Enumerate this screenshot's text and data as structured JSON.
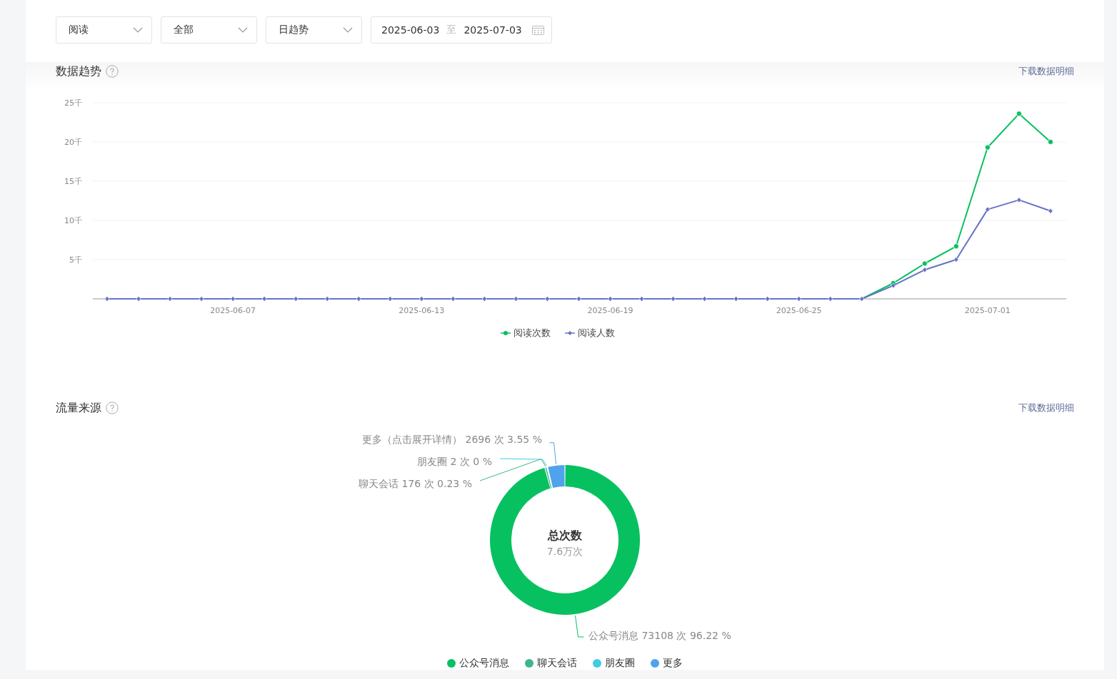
{
  "filters": [
    {
      "value": "阅读"
    },
    {
      "value": "全部"
    },
    {
      "value": "日趋势"
    }
  ],
  "date_range": {
    "start": "2025-06-03",
    "separator": "至",
    "end": "2025-07-03"
  },
  "trend": {
    "title": "数据趋势",
    "download": "下载数据明细",
    "chart_data": {
      "type": "line",
      "categories": [
        null,
        null,
        null,
        null,
        "2025-06-07",
        null,
        null,
        null,
        null,
        null,
        "2025-06-13",
        null,
        null,
        null,
        null,
        null,
        "2025-06-19",
        null,
        null,
        null,
        null,
        null,
        "2025-06-25",
        null,
        null,
        null,
        null,
        null,
        "2025-07-01",
        null,
        null
      ],
      "ylim": [
        0,
        25
      ],
      "yticks": [
        {
          "value": 5,
          "label": "5千"
        },
        {
          "value": 10,
          "label": "10千"
        },
        {
          "value": 15,
          "label": "15千"
        },
        {
          "value": 20,
          "label": "20千"
        },
        {
          "value": 25,
          "label": "25千"
        }
      ],
      "grid": true,
      "legend": "bottom",
      "series": [
        {
          "name": "阅读次数",
          "color": "#07c160",
          "marker": "circle",
          "values": [
            null,
            null,
            null,
            null,
            null,
            null,
            null,
            null,
            null,
            null,
            null,
            null,
            null,
            null,
            null,
            null,
            null,
            null,
            null,
            null,
            null,
            null,
            null,
            null,
            0,
            2,
            4.5,
            6.7,
            19.3,
            23.6,
            20
          ]
        },
        {
          "name": "阅读人数",
          "color": "#6673c7",
          "marker": "diamond",
          "values": [
            0,
            0,
            0,
            0,
            0,
            0,
            0,
            0,
            0,
            0,
            0,
            0,
            0,
            0,
            0,
            0,
            0,
            0,
            0,
            0,
            0,
            0,
            0,
            0,
            0,
            1.7,
            3.7,
            5,
            11.4,
            12.6,
            11.2
          ]
        }
      ]
    }
  },
  "traffic": {
    "title": "流量来源",
    "download": "下载数据明细",
    "chart_data": {
      "type": "donut",
      "categories": [
        "更多（点击展开详情）",
        "朋友圈",
        "聊天会话",
        "公众号消息"
      ],
      "values": [
        3.55,
        0,
        0.23,
        96.22
      ],
      "colors": [
        "#4ea3ec",
        "#41cde0",
        "#3bb88a",
        "#07c160"
      ],
      "legend": "bottom"
    },
    "center_title": "总次数",
    "center_value": "7.6万次",
    "slice_details": [
      "2696 次 3.55 %",
      "2 次 0 %",
      "176 次 0.23 %",
      "73108 次 96.22 %"
    ],
    "legend": [
      {
        "name": "公众号消息",
        "color": "#07c160"
      },
      {
        "name": "聊天会话",
        "color": "#3bb88a"
      },
      {
        "name": "朋友圈",
        "color": "#41cde0"
      },
      {
        "name": "更多",
        "color": "#4ea3ec"
      }
    ]
  }
}
